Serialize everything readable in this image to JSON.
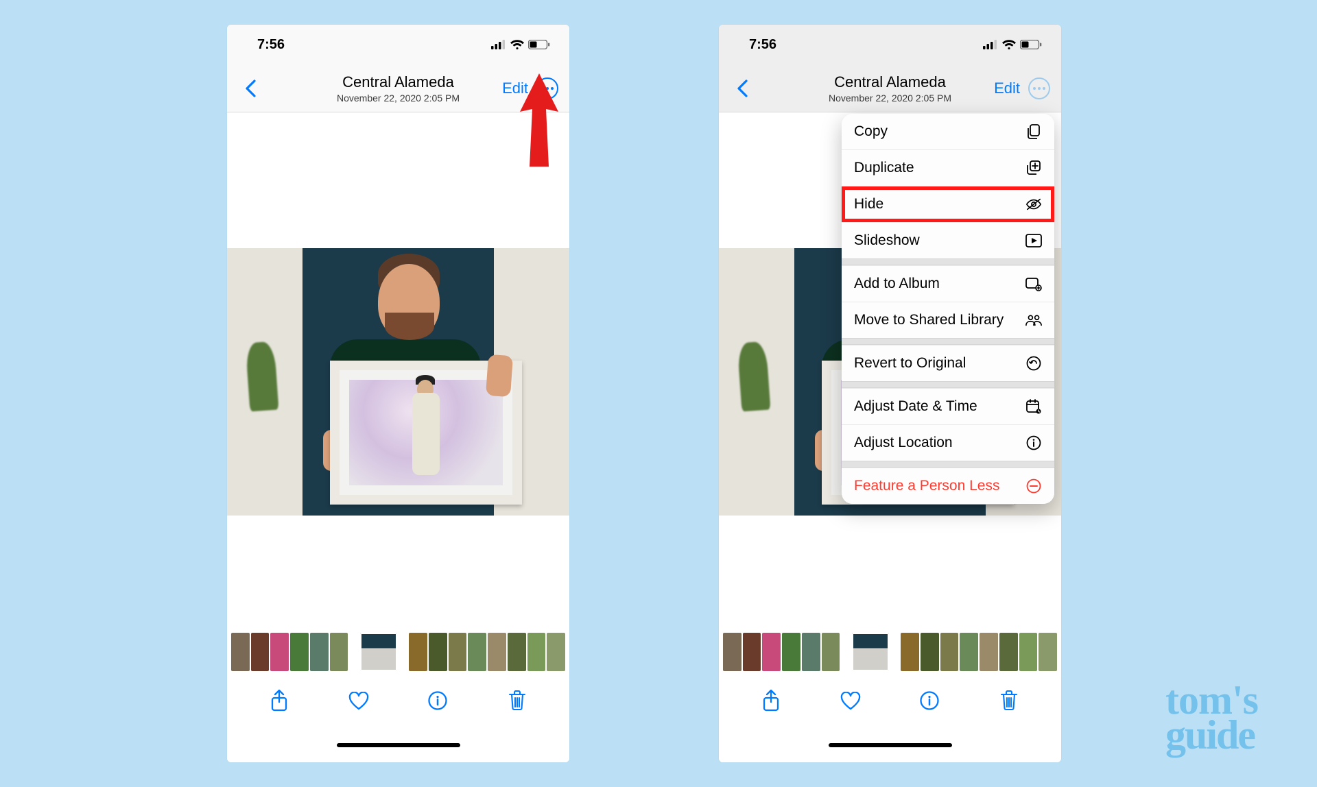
{
  "status": {
    "time": "7:56"
  },
  "header": {
    "title": "Central Alameda",
    "subtitle": "November 22, 2020  2:05 PM",
    "edit_label": "Edit"
  },
  "menu": {
    "items": [
      {
        "label": "Copy",
        "icon": "copy-icon"
      },
      {
        "label": "Duplicate",
        "icon": "duplicate-icon"
      },
      {
        "label": "Hide",
        "icon": "hide-icon",
        "highlight": true
      },
      {
        "label": "Slideshow",
        "icon": "slideshow-icon"
      }
    ],
    "items2": [
      {
        "label": "Add to Album",
        "icon": "add-album-icon"
      },
      {
        "label": "Move to Shared Library",
        "icon": "shared-library-icon"
      }
    ],
    "items3": [
      {
        "label": "Revert to Original",
        "icon": "revert-icon"
      }
    ],
    "items4": [
      {
        "label": "Adjust Date & Time",
        "icon": "calendar-icon"
      },
      {
        "label": "Adjust Location",
        "icon": "location-info-icon"
      }
    ],
    "items5": [
      {
        "label": "Feature a Person Less",
        "icon": "minus-circle-icon",
        "red": true
      }
    ]
  },
  "watermark": {
    "line1": "tom's",
    "line2": "guide"
  },
  "thumb_colors_left": [
    "#7a6a55",
    "#6a3a2a",
    "#c74a7a",
    "#4a7a3a",
    "#5a7a6a",
    "#7a8a5a"
  ],
  "thumb_colors_right": [
    "#8a6a2a",
    "#4a5a2a",
    "#7a7a4a",
    "#6a8a5a",
    "#9a8a6a",
    "#5a6a3a",
    "#7a9a5a",
    "#8a9a6a"
  ]
}
